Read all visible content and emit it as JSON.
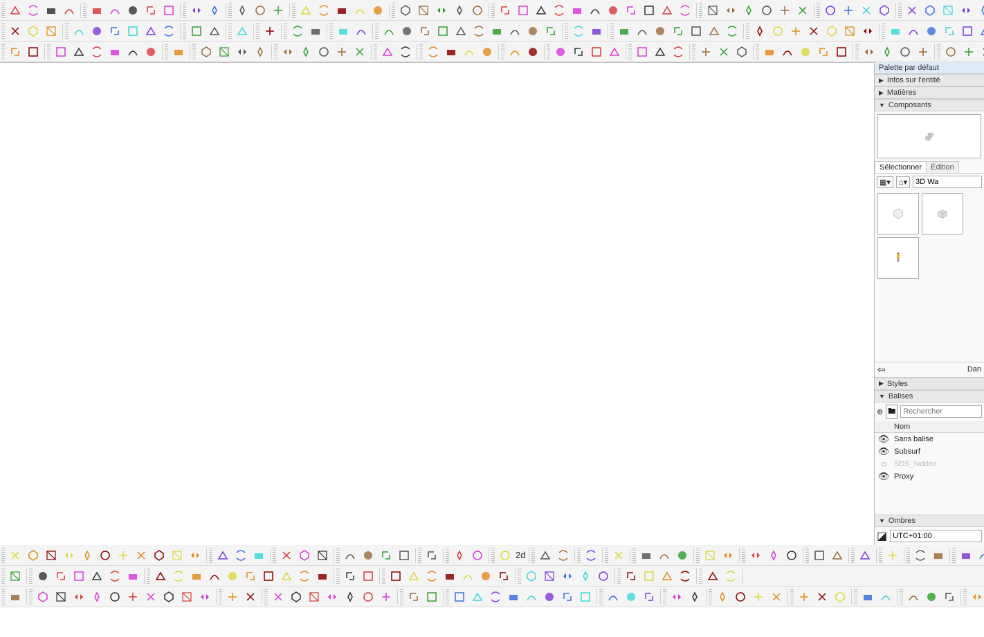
{
  "side": {
    "palette_title": "Palette par défaut",
    "sections": {
      "entity": "Infos sur l'entité",
      "materials": "Matières",
      "components": "Composants",
      "styles": "Styles",
      "tags": "Balises",
      "shadows": "Ombres"
    },
    "tabs": {
      "select": "Sélectionner",
      "edit": "Édition"
    },
    "model_source": "3D Wa",
    "nav_label": "Dan",
    "tag_header": "Nom",
    "tags_items": [
      {
        "name": "Sans balise",
        "visible": true,
        "dim": false
      },
      {
        "name": "Subsurf",
        "visible": true,
        "dim": false
      },
      {
        "name": "SDS_hidden",
        "visible": false,
        "dim": true
      },
      {
        "name": "Proxy",
        "visible": true,
        "dim": false
      }
    ],
    "tag_search_placeholder": "Rechercher",
    "timezone": "UTC+01:00"
  },
  "toolbar_groups": {
    "row1": [
      4,
      5,
      2,
      3,
      5,
      5,
      11,
      6,
      4,
      7,
      4,
      2,
      4,
      4,
      2,
      3
    ],
    "row2": [
      3,
      6,
      2,
      1,
      1,
      2,
      2,
      10,
      2,
      7,
      7,
      6,
      4,
      4,
      2,
      2
    ],
    "row3": [
      2,
      6,
      1,
      4,
      5,
      2,
      4,
      2,
      4,
      3,
      3,
      5,
      4,
      4,
      2,
      3,
      4,
      3
    ],
    "row4": [
      11,
      3,
      3,
      4,
      1,
      2,
      1,
      2,
      1,
      1,
      3,
      2,
      3,
      2,
      1,
      1,
      2,
      5,
      1,
      4,
      1,
      4
    ],
    "row5": [
      1,
      6,
      10,
      2,
      7,
      5,
      4,
      2
    ],
    "row6": [
      1,
      10,
      2,
      7,
      2,
      8,
      3,
      2,
      4,
      3,
      2,
      3,
      2,
      2,
      4
    ]
  },
  "labels": {
    "label_2d": "2d"
  },
  "icon_colors": [
    "#3a6fd8",
    "#d83a3a",
    "#2e9e2e",
    "#e08b1a",
    "#7b3ad8",
    "#333333",
    "#9a6a3a",
    "#d8d83a",
    "#3ad8d8",
    "#d83ad8",
    "#555555",
    "#8b0000"
  ]
}
